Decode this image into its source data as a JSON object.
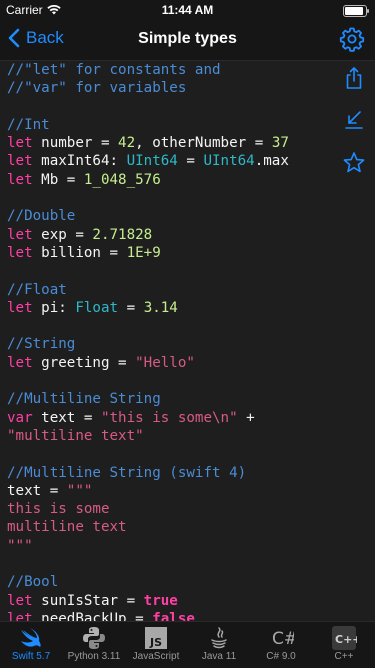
{
  "status": {
    "carrier": "Carrier",
    "time": "11:44 AM"
  },
  "nav": {
    "back_label": "Back",
    "title": "Simple types"
  },
  "code": {
    "comment_let": "//\"let\" for constants and",
    "comment_var": "//\"var\" for variables",
    "comment_int": "//Int",
    "line_int_1_kw": "let",
    "line_int_1_rest": " number = ",
    "line_int_1_num": "42",
    "line_int_1_rest2": ", otherNumber = ",
    "line_int_1_num2": "37",
    "line_int_2_kw": "let",
    "line_int_2_rest": " maxInt64: ",
    "line_int_2_type": "UInt64",
    "line_int_2_eq": " = ",
    "line_int_2_type2": "UInt64",
    "line_int_2_tail": ".max",
    "line_int_3_kw": "let",
    "line_int_3_rest": " Mb = ",
    "line_int_3_num": "1_048_576",
    "comment_double": "//Double",
    "line_d1_kw": "let",
    "line_d1_rest": " exp = ",
    "line_d1_num": "2.71828",
    "line_d2_kw": "let",
    "line_d2_rest": " billion = ",
    "line_d2_num": "1E+9",
    "comment_float": "//Float",
    "line_f1_kw": "let",
    "line_f1_rest": " pi: ",
    "line_f1_type": "Float",
    "line_f1_eq": " = ",
    "line_f1_num": "3.14",
    "comment_string": "//String",
    "line_s1_kw": "let",
    "line_s1_rest": " greeting = ",
    "line_s1_str": "\"Hello\"",
    "comment_multiline": "//Multiline String",
    "line_m1_kw": "var",
    "line_m1_rest": " text = ",
    "line_m1_str": "\"this is some\\n\"",
    "line_m1_plus": " +",
    "line_m2_str": "\"multiline text\"",
    "comment_multiline4": "//Multiline String (swift 4)",
    "line_m4_rest": "text = ",
    "line_m4_str": "\"\"\"",
    "line_m4_body1": "this is some",
    "line_m4_body2": "multiline text",
    "line_m4_close": "\"\"\"",
    "comment_bool": "//Bool",
    "line_b1_kw": "let",
    "line_b1_rest": " sunIsStar = ",
    "line_b1_val": "true",
    "line_b2_kw": "let",
    "line_b2_rest": " needBackUp = ",
    "line_b2_val": "false"
  },
  "side_icons": [
    "share-icon",
    "collapse-icon",
    "star-icon"
  ],
  "tabs": [
    {
      "label": "Swift 5.7",
      "icon": "swift-icon",
      "active": true
    },
    {
      "label": "Python 3.11",
      "icon": "python-icon",
      "active": false
    },
    {
      "label": "JavaScript",
      "icon": "javascript-icon",
      "active": false
    },
    {
      "label": "Java 11",
      "icon": "java-icon",
      "active": false
    },
    {
      "label": "C# 9.0",
      "icon": "csharp-icon",
      "active": false
    },
    {
      "label": "C++",
      "icon": "cpp-icon",
      "active": false
    }
  ],
  "colors": {
    "accent": "#1e8cff",
    "comment": "#4a8cd6",
    "keyword": "#ff3fa4",
    "number": "#c6ed8f",
    "type": "#2cb9c8",
    "string": "#d85a86"
  }
}
